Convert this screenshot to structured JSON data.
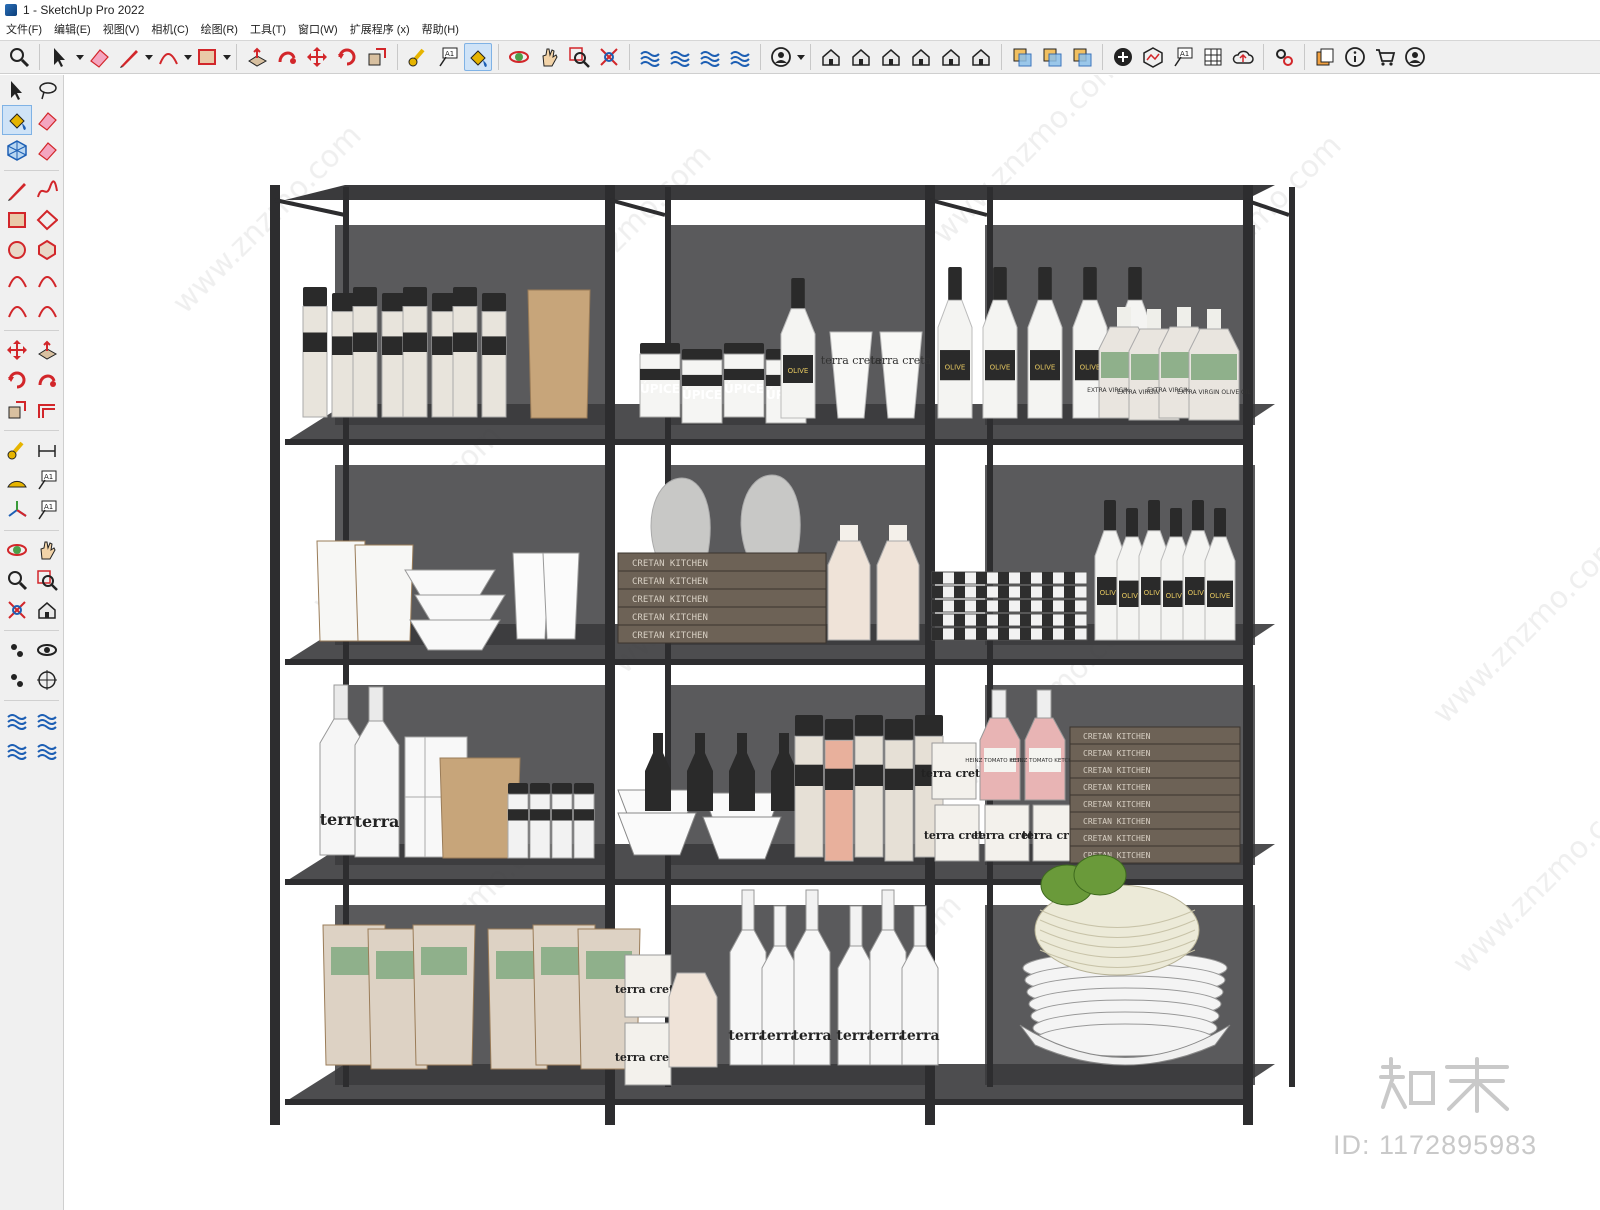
{
  "window": {
    "title": "1 - SketchUp Pro 2022"
  },
  "menu": {
    "items": [
      "文件(F)",
      "编辑(E)",
      "视图(V)",
      "相机(C)",
      "绘图(R)",
      "工具(T)",
      "窗口(W)",
      "扩展程序 (x)",
      "帮助(H)"
    ]
  },
  "toolbar": {
    "tools": [
      "zoom-icon",
      "select-icon",
      "eraser-icon",
      "pencil-line-icon",
      "arc-icon",
      "rectangle-icon",
      "push-pull-icon",
      "follow-me-icon",
      "move-icon",
      "rotate-icon",
      "scale-icon",
      "tape-measure-icon",
      "text-label-icon",
      "paint-bucket-icon",
      "orbit-icon",
      "pan-icon",
      "zoom-window-icon",
      "zoom-extents-icon",
      "sandbox-from-contours-icon",
      "sandbox-from-scratch-icon",
      "smoove-icon",
      "stamp-icon",
      "user-account-icon",
      "iso-view-icon",
      "top-view-icon",
      "front-view-icon",
      "right-view-icon",
      "back-view-icon",
      "left-view-icon",
      "solid-inspector-icon",
      "outer-shell-icon",
      "intersect-icon",
      "add-location-icon",
      "toggle-terrain-icon",
      "photo-textures-icon",
      "3d-warehouse-icon",
      "cloud-upload-icon",
      "extension-manager-icon",
      "layout-icon",
      "info-icon",
      "shop-icon",
      "profile-icon"
    ],
    "active_tool": "paint-bucket-icon"
  },
  "palette": {
    "tools": [
      [
        "select-icon",
        "lasso-icon"
      ],
      [
        "paint-bucket-icon",
        "eraser-icon"
      ],
      [
        "component-icon",
        "tag-eraser-icon"
      ],
      [
        "line-icon",
        "freehand-icon"
      ],
      [
        "rectangle-icon",
        "rotated-rectangle-icon"
      ],
      [
        "circle-icon",
        "polygon-icon"
      ],
      [
        "arc-icon",
        "two-point-arc-icon"
      ],
      [
        "three-point-arc-icon",
        "pie-icon"
      ],
      [
        "move-icon",
        "push-pull-icon"
      ],
      [
        "rotate-icon",
        "follow-me-icon"
      ],
      [
        "scale-icon",
        "offset-icon"
      ],
      [
        "tape-measure-icon",
        "dimension-icon"
      ],
      [
        "protractor-icon",
        "text-icon"
      ],
      [
        "axes-icon",
        "3d-text-icon"
      ],
      [
        "orbit-icon",
        "pan-icon"
      ],
      [
        "zoom-icon",
        "zoom-window-icon"
      ],
      [
        "zoom-extents-icon",
        "previous-view-icon"
      ],
      [
        "position-camera-icon",
        "look-around-icon"
      ],
      [
        "walk-icon",
        "section-plane-icon"
      ],
      [
        "sandbox-contours-icon",
        "sandbox-scratch-icon"
      ],
      [
        "smoove-icon",
        "stamp-icon"
      ]
    ],
    "active_tool": "paint-bucket-icon"
  },
  "scene": {
    "model": "metal-shelving-unit-with-pantry-items",
    "colors": {
      "frame": "#2d2d2f",
      "panel": "#5a5a5c",
      "shelf": "#3a3a3c",
      "bottle": "#f4f4f2",
      "label_dark": "#2a2a2a",
      "kraft": "#c7a57a",
      "box": "#6d6256",
      "olive_label": "#8fb08b",
      "sauce": "#e8b4b4",
      "basket": "#ecead8",
      "apple": "#6a9a3a"
    },
    "product_texts": {
      "brand": "terra creta",
      "jar": "ÚPICE",
      "olive": "OLIVE",
      "oil": "EXTRA VIRGIN OLIVE OIL",
      "ketchup": "HEINZ TOMATO KETCHUP",
      "book": "CRETAN KITCHEN"
    }
  },
  "watermark": {
    "site": "www.znzmo.com",
    "brand_cn": "知末网",
    "brand_logo": "知末",
    "id_text": "ID: 1172895983"
  }
}
